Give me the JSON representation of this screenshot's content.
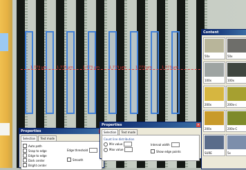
{
  "measure": {
    "label": "1.773 µm"
  },
  "properties_front": {
    "title": "Properties",
    "tabs": [
      "Selection",
      "Text mode"
    ],
    "group": "Count line distribution",
    "options": [
      "Min value",
      "Max value"
    ],
    "field1": "Interval width",
    "chk": "Show edge points"
  },
  "properties_back": {
    "title": "Properties",
    "tabs": [
      "Selection",
      "Text mode"
    ],
    "items": [
      "Auto path",
      "Snap to edge",
      "Edge to edge",
      "Dark center",
      "Bright center"
    ],
    "threshold_label": "Edge threshold",
    "smooth_label": "Smooth"
  },
  "content": {
    "title": "Content",
    "items": [
      {
        "cap": "50x",
        "color": "#b8b59a"
      },
      {
        "cap": "50x",
        "color": "#6e6e6a"
      },
      {
        "cap": "100x",
        "color": "#9ea4a2"
      },
      {
        "cap": "100x",
        "color": "#3f463f"
      },
      {
        "cap": "200x",
        "color": "#d6b640"
      },
      {
        "cap": "200x-c",
        "color": "#a6a030"
      },
      {
        "cap": "200x",
        "color": "#c89a2a"
      },
      {
        "cap": "200x-C",
        "color": "#7e8a2a"
      },
      {
        "cap": "SURE",
        "color": "#5a6c8a"
      },
      {
        "cap": "5x",
        "color": "#7c8eab"
      }
    ]
  }
}
